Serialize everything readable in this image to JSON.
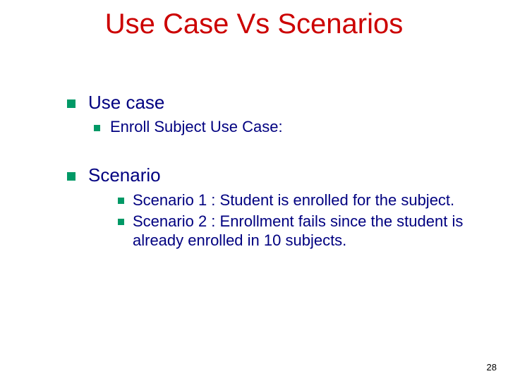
{
  "title": "Use Case Vs Scenarios",
  "sections": [
    {
      "heading": "Use case",
      "level2": [
        {
          "text": "Enroll  Subject Use Case:"
        }
      ],
      "level3": []
    },
    {
      "heading": "Scenario",
      "level2": [],
      "level3": [
        {
          "text": "Scenario 1 : Student is enrolled for the subject."
        },
        {
          "text": "Scenario 2 : Enrollment fails since the student is already enrolled in 10 subjects."
        }
      ]
    }
  ],
  "pageNumber": "28"
}
